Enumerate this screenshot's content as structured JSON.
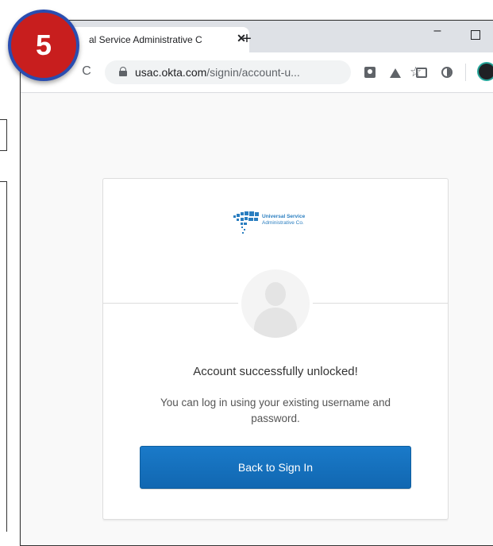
{
  "step_badge": {
    "number": "5",
    "color": "#c81e1e",
    "ring_color": "#2a4db0"
  },
  "browser": {
    "tab": {
      "title": "al Service Administrative C",
      "close_symbol": "✕"
    },
    "new_tab_symbol": "+",
    "window_controls": {
      "minimize_symbol": "–"
    },
    "address_bar": {
      "host": "usac.okta.com",
      "path": "/signin/account-u..."
    },
    "bookmark_symbol": "☆",
    "reload_symbol": "C"
  },
  "card": {
    "logo": {
      "line1": "Universal Service",
      "line2": "Administrative Co.",
      "color": "#2a7ec0"
    },
    "heading": "Account successfully unlocked!",
    "message": "You can log in using your existing username and password.",
    "button_label": "Back to Sign In",
    "button_color": "#1a73c0"
  }
}
